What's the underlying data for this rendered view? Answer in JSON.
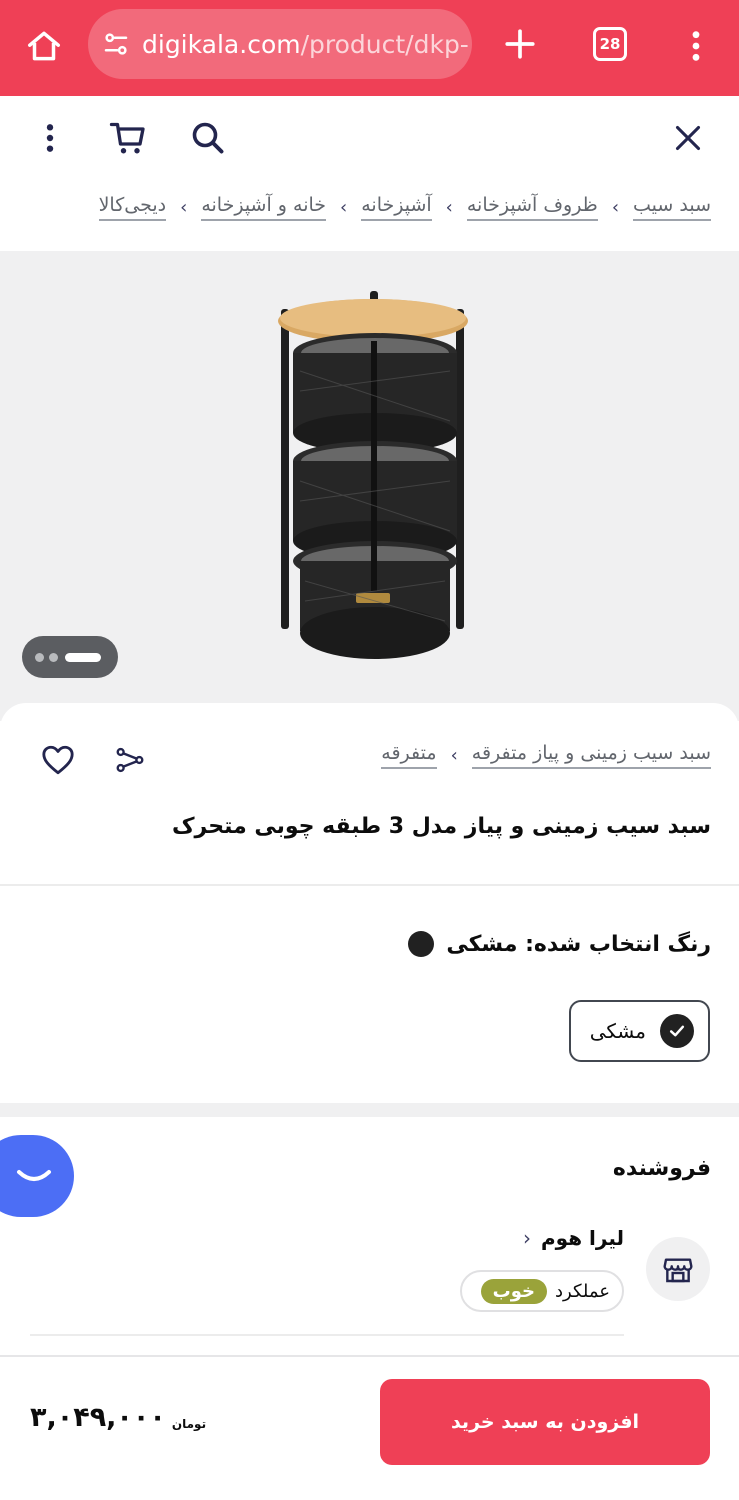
{
  "browser": {
    "url_main": "digikala.com",
    "url_path": "/product/dkp-",
    "tab_count": "28"
  },
  "breadcrumb": [
    "دیجی‌کالا",
    "خانه و آشپزخانه",
    "آشپزخانه",
    "ظروف آشپزخانه",
    "سبد سیب"
  ],
  "breadcrumb_separator": "›",
  "product": {
    "category_crumbs": [
      "متفرقه",
      "سبد سیب زمینی و پیاز متفرقه"
    ],
    "title": "سبد سیب زمینی و پیاز مدل 3 طبقه چوبی متحرک",
    "selected_color_label": "رنگ انتخاب شده: مشکی",
    "color_option": "مشکی",
    "color_hex": "#212121"
  },
  "gallery": {
    "image_count_dots": 3,
    "active_index": 2
  },
  "seller": {
    "heading": "فروشنده",
    "name": "لیرا هوم",
    "performance_label": "عملکرد",
    "performance_value": "خوب"
  },
  "buy": {
    "button_label": "افزودن به سبد خرید",
    "price": "۳,۰۴۹,۰۰۰",
    "currency": "تومان"
  },
  "colors": {
    "brand": "#ef4056",
    "chat_fab": "#4c6ef5",
    "badge_good": "#9aa33a"
  },
  "icons": [
    "home-icon",
    "tune-icon",
    "plus-icon",
    "tabs-icon",
    "more-vert-icon",
    "close-icon",
    "search-icon",
    "cart-icon",
    "share-icon",
    "heart-icon",
    "check-icon",
    "store-icon",
    "chat-icon"
  ]
}
